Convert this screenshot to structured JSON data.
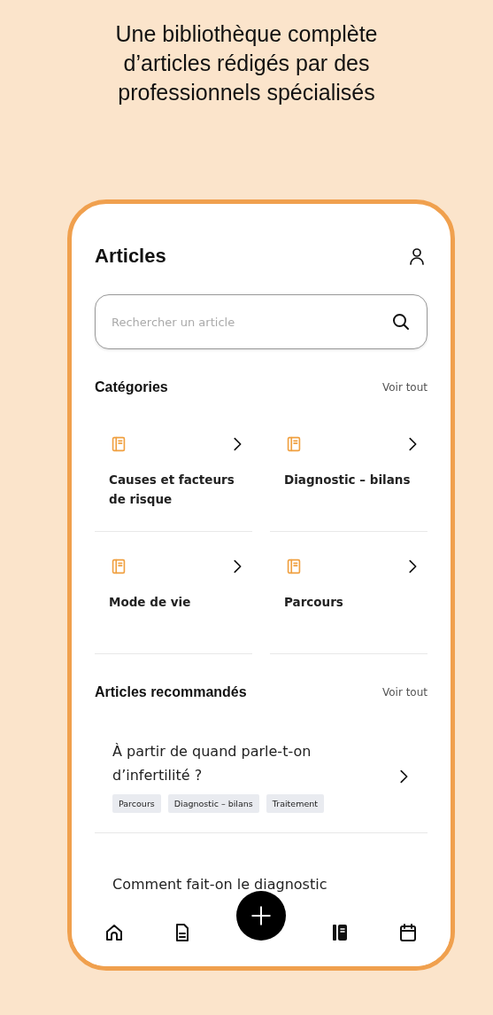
{
  "headline": "Une bibliothèque complète\nd’articles rédigés par des\nprofessionnels spécialisés",
  "screen": {
    "title": "Articles",
    "search": {
      "placeholder": "Rechercher un article"
    },
    "categories": {
      "title": "Catégories",
      "see_all": "Voir tout",
      "items": [
        {
          "label": "Causes et facteurs de risque"
        },
        {
          "label": "Diagnostic – bilans"
        },
        {
          "label": "Mode de vie"
        },
        {
          "label": "Parcours"
        }
      ]
    },
    "recommended": {
      "title": "Articles recommandés",
      "see_all": "Voir tout",
      "articles": [
        {
          "title": "À partir de quand parle-t-on d’infertilité ?",
          "tags": [
            "Parcours",
            "Diagnostic – bilans",
            "Traitement"
          ]
        },
        {
          "title": "Comment fait-on le diagnostic"
        }
      ]
    },
    "nav": [
      {
        "kind": "home",
        "selected": false
      },
      {
        "kind": "document",
        "selected": false
      },
      {
        "kind": "add",
        "selected": false
      },
      {
        "kind": "book",
        "selected": true
      },
      {
        "kind": "calendar",
        "selected": false
      }
    ]
  }
}
